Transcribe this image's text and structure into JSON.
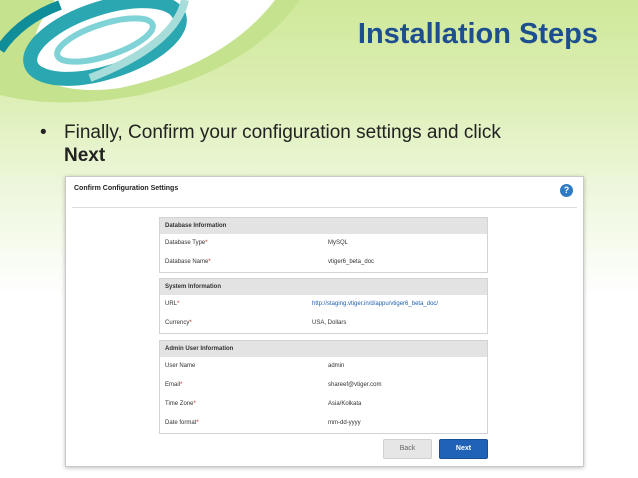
{
  "slide": {
    "title": "Installation Steps",
    "bullet_symbol": "•",
    "bullet_text": "Finally, Confirm your configuration settings and click",
    "bullet_strong": "Next"
  },
  "panel": {
    "title": "Confirm Configuration Settings",
    "help_icon": "?",
    "sections": [
      {
        "heading": "Database Information",
        "rows": [
          {
            "label": "Database Type",
            "value": "MySQL"
          },
          {
            "label": "Database Name",
            "value": "vtiger6_beta_doc"
          }
        ]
      },
      {
        "heading": "System Information",
        "rows": [
          {
            "label": "URL",
            "value": "http://staging.vtiger.in/d/appu/vtiger6_beta_doc/"
          },
          {
            "label": "Currency",
            "value": "USA, Dollars"
          }
        ]
      },
      {
        "heading": "Admin User Information",
        "rows": [
          {
            "label": "User Name",
            "value": "admin"
          },
          {
            "label": "Email",
            "value": "shareef@vtiger.com"
          },
          {
            "label": "Time Zone",
            "value": "Asia/Kolkata"
          },
          {
            "label": "Date format",
            "value": "mm-dd-yyyy"
          }
        ]
      }
    ],
    "required_marker": "*",
    "back_label": "Back",
    "next_label": "Next"
  },
  "colors": {
    "title": "#1d4e8f",
    "next_button": "#1f62b8",
    "required": "#d02020",
    "decor_teal": "#2aa7b0",
    "decor_green": "#8cc63f"
  }
}
